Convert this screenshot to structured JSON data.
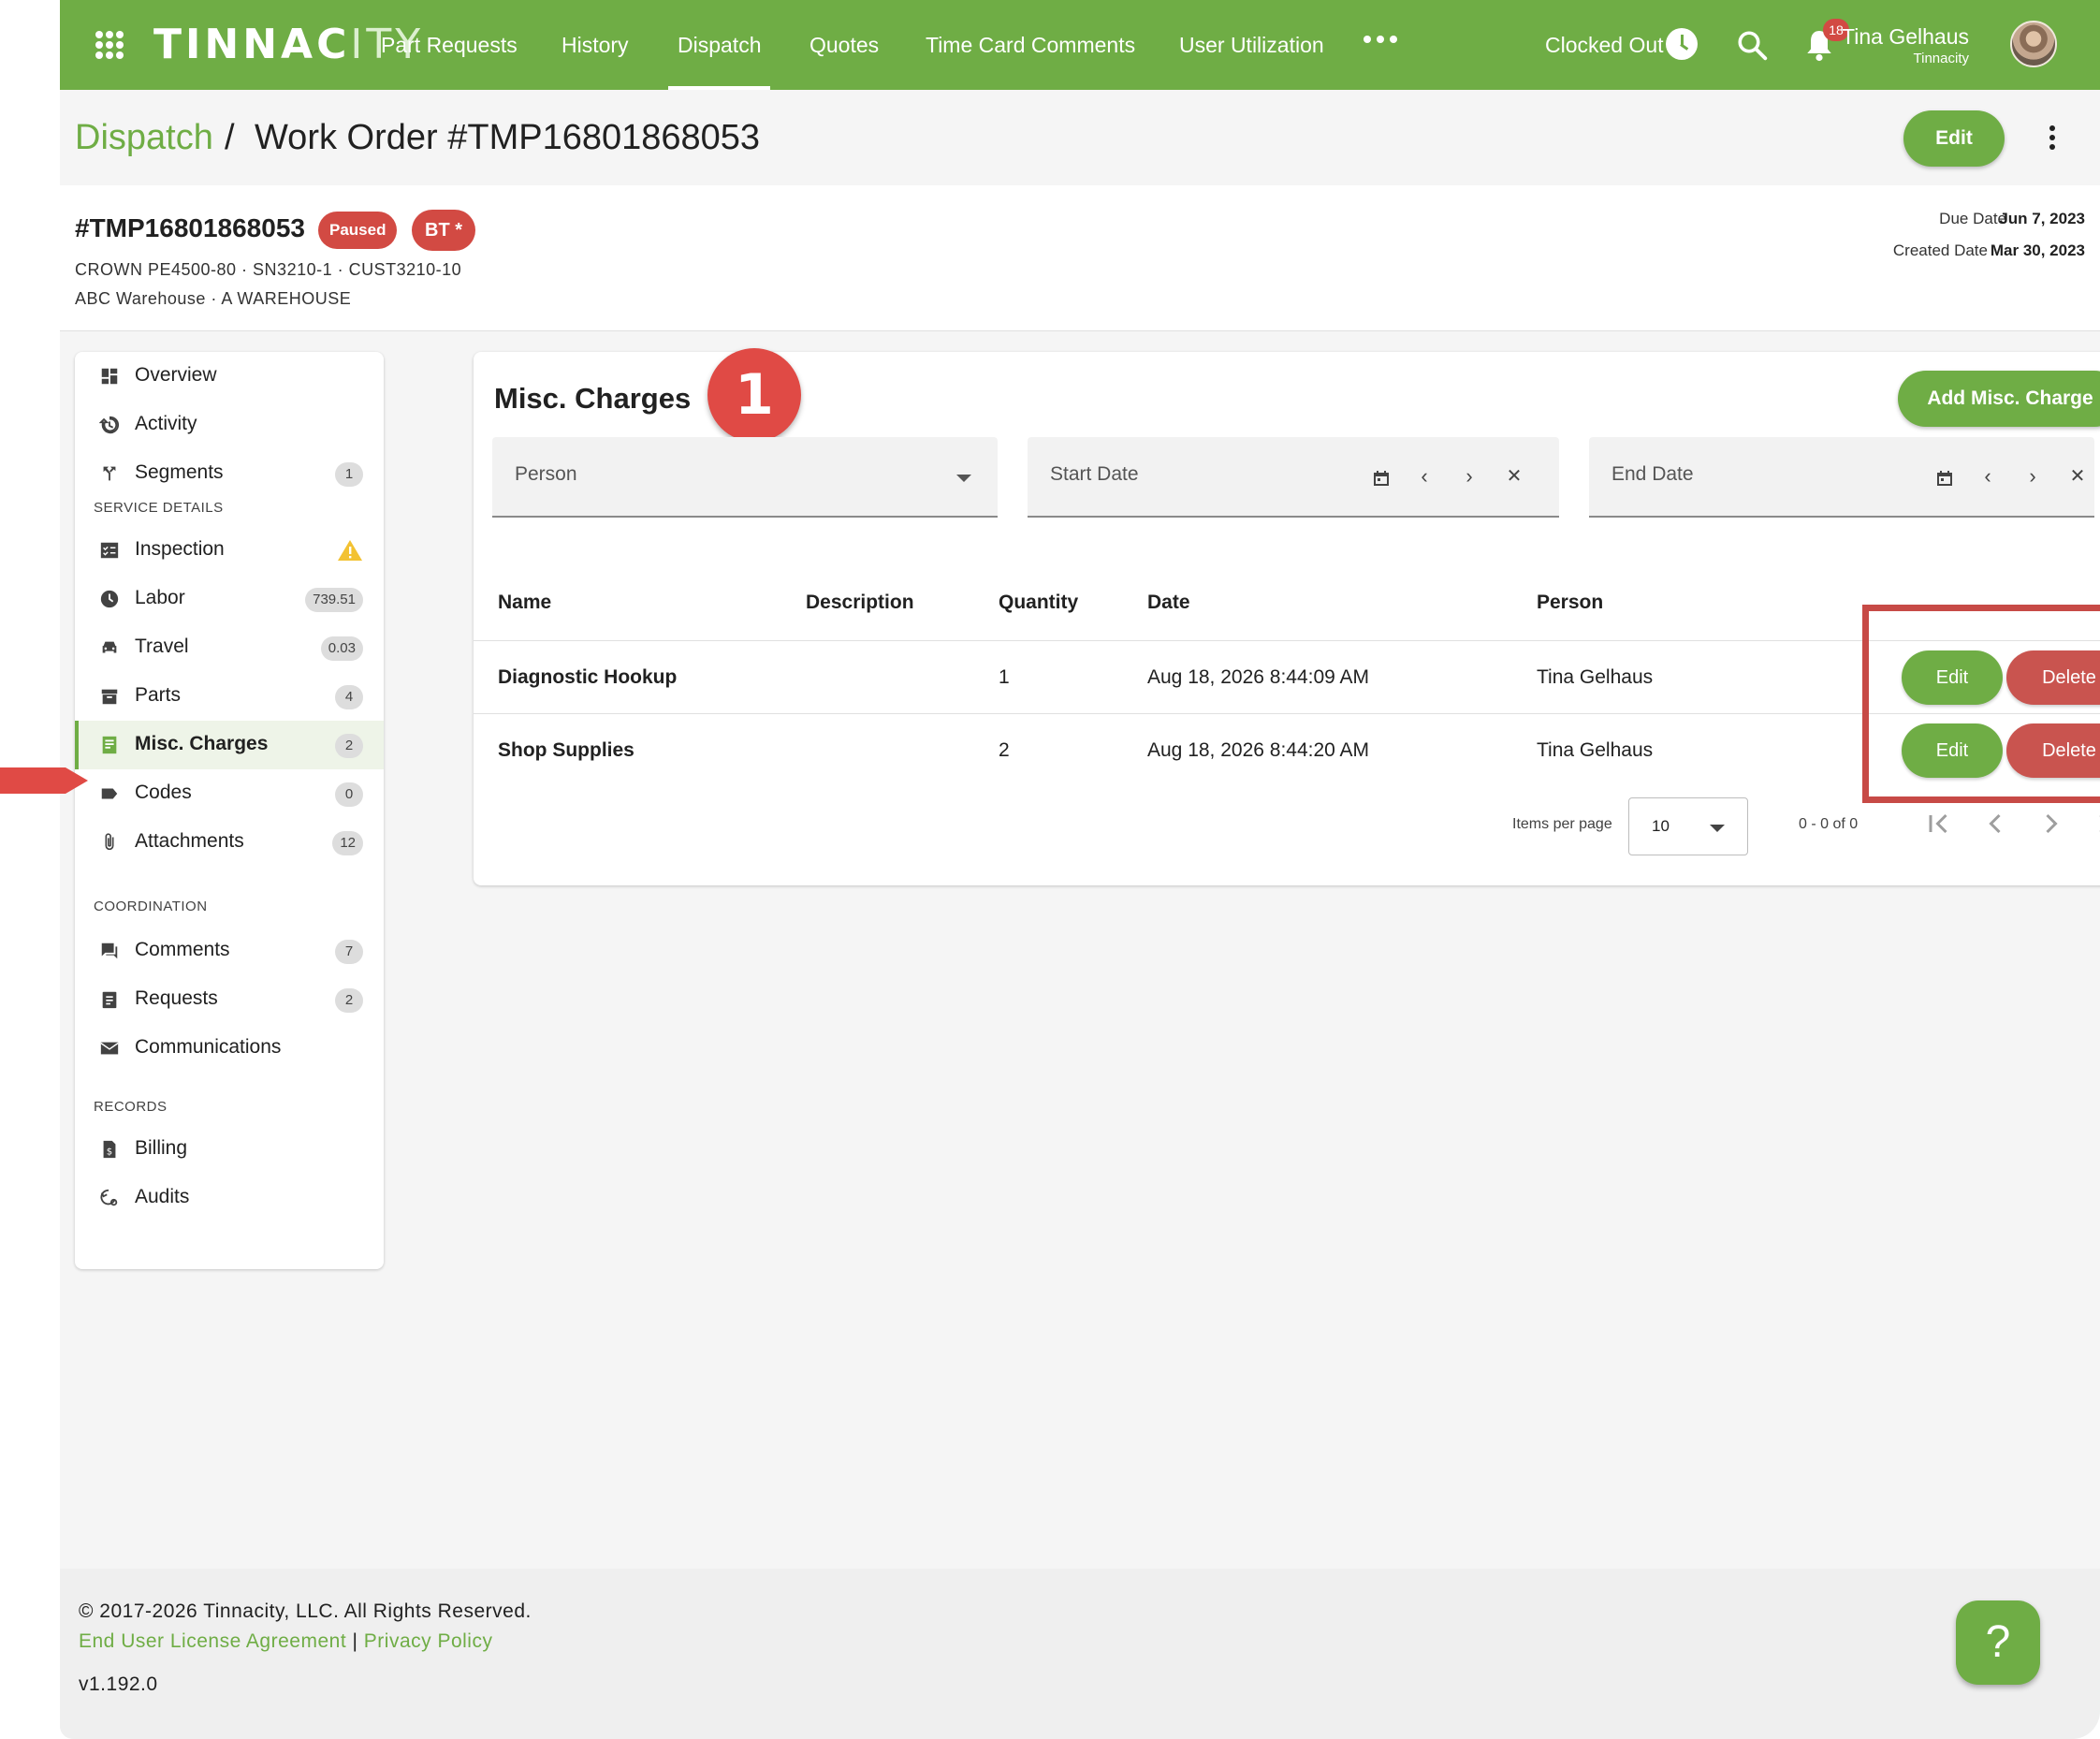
{
  "nav": {
    "logo_main": "TINNAC",
    "logo_light": "ITY",
    "items": [
      "Part Requests",
      "History",
      "Dispatch",
      "Quotes",
      "Time Card Comments",
      "User Utilization"
    ],
    "active": "Dispatch",
    "clock_status": "Clocked Out",
    "notification_count": "18",
    "user_name": "Tina Gelhaus",
    "user_org": "Tinnacity"
  },
  "header": {
    "breadcrumb_root": "Dispatch",
    "breadcrumb_separator": "/",
    "title": "Work Order #TMP16801868053",
    "edit_label": "Edit"
  },
  "work_order": {
    "number": "#TMP16801868053",
    "status_badge": "Paused",
    "tag_badge": "BT *",
    "equipment_line": "CROWN PE4500-80 · SN3210-1 · CUST3210-10",
    "location_line": "ABC Warehouse · A WAREHOUSE",
    "due_date_label": "Due Date",
    "due_date": "Jun 7, 2023",
    "created_date_label": "Created Date",
    "created_date": "Mar 30, 2023"
  },
  "sidebar": {
    "items_top": [
      {
        "label": "Overview",
        "icon": "dashboard-icon",
        "count": ""
      },
      {
        "label": "Activity",
        "icon": "history-icon",
        "count": ""
      },
      {
        "label": "Segments",
        "icon": "segments-icon",
        "count": "1"
      }
    ],
    "section_service": "SERVICE DETAILS",
    "items_service": [
      {
        "label": "Inspection",
        "icon": "checklist-icon",
        "count": "",
        "warning": true
      },
      {
        "label": "Labor",
        "icon": "clock-icon",
        "count": "739.51"
      },
      {
        "label": "Travel",
        "icon": "car-icon",
        "count": "0.03"
      },
      {
        "label": "Parts",
        "icon": "box-icon",
        "count": "4"
      },
      {
        "label": "Misc. Charges",
        "icon": "receipt-icon",
        "count": "2",
        "active": true
      },
      {
        "label": "Codes",
        "icon": "label-icon",
        "count": "0"
      },
      {
        "label": "Attachments",
        "icon": "paperclip-icon",
        "count": "12"
      }
    ],
    "section_coordination": "COORDINATION",
    "items_coordination": [
      {
        "label": "Comments",
        "icon": "comment-icon",
        "count": "7"
      },
      {
        "label": "Requests",
        "icon": "clipboard-icon",
        "count": "2"
      },
      {
        "label": "Communications",
        "icon": "mail-icon",
        "count": ""
      }
    ],
    "section_records": "RECORDS",
    "items_records": [
      {
        "label": "Billing",
        "icon": "billing-icon",
        "count": ""
      },
      {
        "label": "Audits",
        "icon": "audit-icon",
        "count": ""
      }
    ]
  },
  "main": {
    "title": "Misc. Charges",
    "step_number": "1",
    "add_button": "Add Misc. Charge",
    "filters": {
      "person_label": "Person",
      "start_date_label": "Start Date",
      "end_date_label": "End Date"
    },
    "columns": [
      "Name",
      "Description",
      "Quantity",
      "Date",
      "Person"
    ],
    "rows": [
      {
        "name": "Diagnostic Hookup",
        "description": "",
        "quantity": "1",
        "date": "Aug 18, 2026 8:44:09 AM",
        "person": "Tina Gelhaus",
        "edit": "Edit",
        "delete": "Delete"
      },
      {
        "name": "Shop Supplies",
        "description": "",
        "quantity": "2",
        "date": "Aug 18, 2026 8:44:20 AM",
        "person": "Tina Gelhaus",
        "edit": "Edit",
        "delete": "Delete"
      }
    ],
    "pagination": {
      "items_per_page_label": "Items per page",
      "items_per_page": "10",
      "range": "0 - 0 of 0"
    }
  },
  "footer": {
    "copyright": "© 2017-2026 Tinnacity, LLC. All Rights Reserved.",
    "eula": "End User License Agreement",
    "separator": " | ",
    "privacy": "Privacy Policy",
    "version": "v1.192.0",
    "help": "?"
  },
  "colors": {
    "brand_green": "#6fad45",
    "danger_red": "#d24a43",
    "highlight_red": "#c74a46"
  }
}
